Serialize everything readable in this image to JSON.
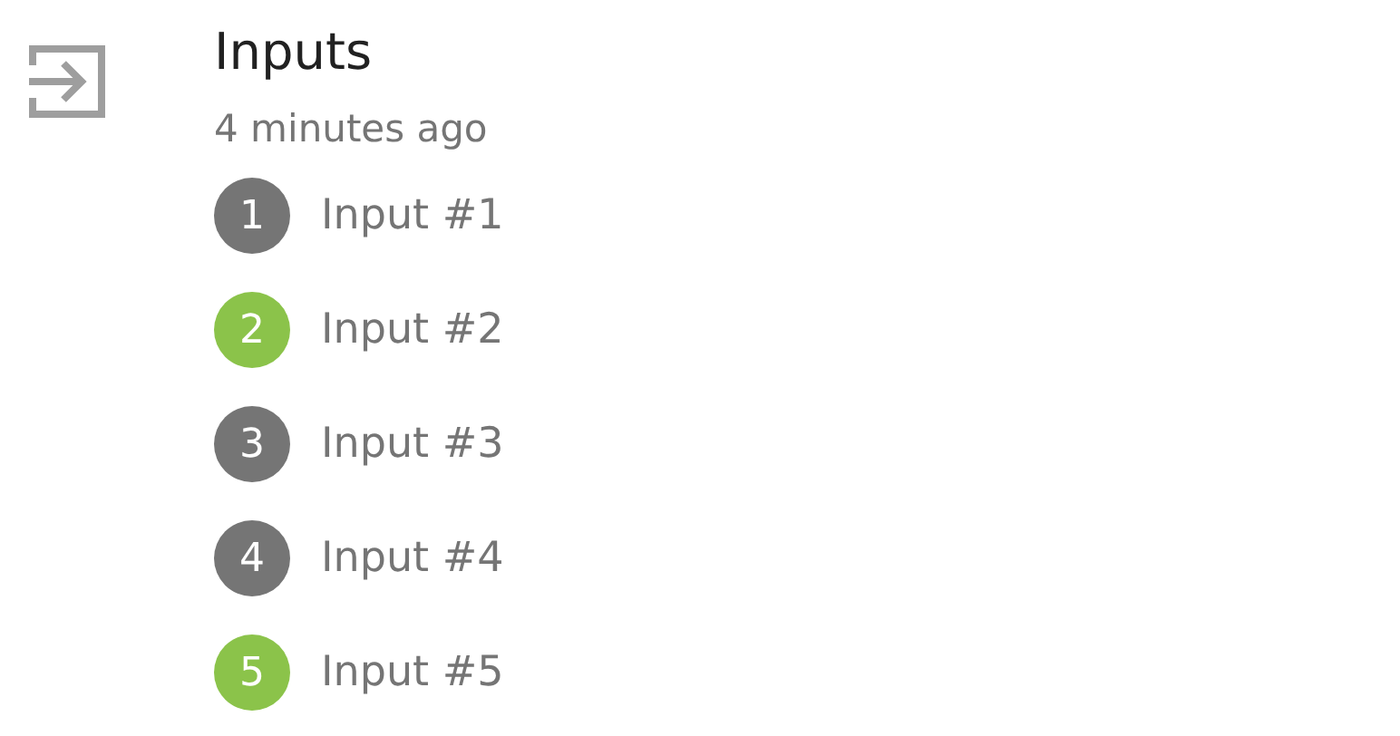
{
  "title": "Inputs",
  "time": "4 minutes ago",
  "inputs": [
    {
      "number": "1",
      "label": "Input #1",
      "color": "#757575"
    },
    {
      "number": "2",
      "label": "Input #2",
      "color": "#8bc34a"
    },
    {
      "number": "3",
      "label": "Input #3",
      "color": "#757575"
    },
    {
      "number": "4",
      "label": "Input #4",
      "color": "#757575"
    },
    {
      "number": "5",
      "label": "Input #5",
      "color": "#8bc34a"
    }
  ]
}
